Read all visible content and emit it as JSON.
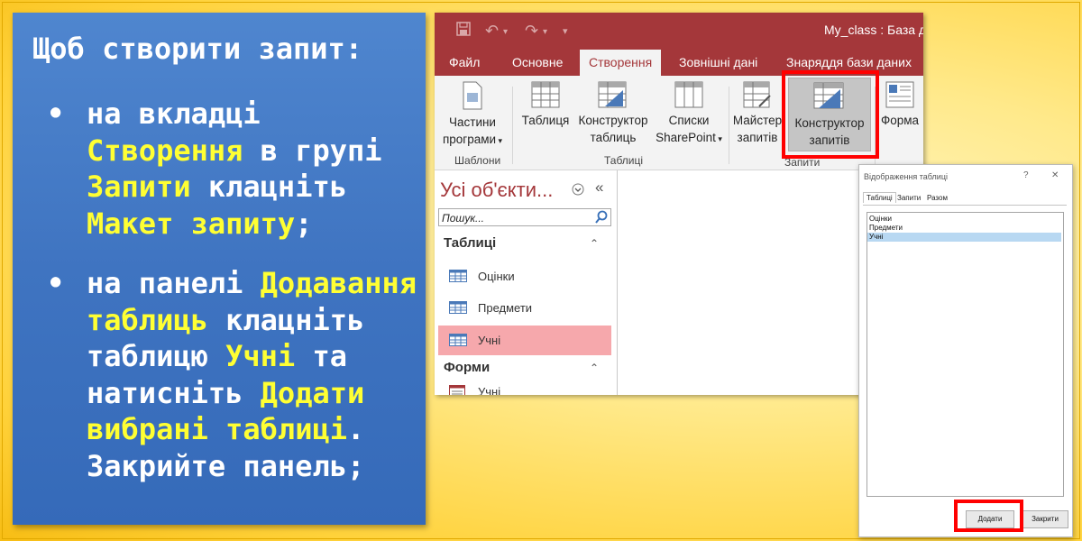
{
  "instructions": {
    "heading": "Щоб створити запит:",
    "bullet1": {
      "lines": [
        "на вкладці",
        "Створення в групі",
        "Запити клацніть",
        "Макет запиту;"
      ],
      "p1": "на вкладці ",
      "h1": "Створення",
      "p2": " в групі ",
      "h2": "Запити",
      "p3": " клацніть ",
      "h3": "Макет запиту",
      "p4": ";"
    },
    "bullet2": {
      "p1": "на панелі ",
      "h1": "Додавання таблиць",
      "p2": " клацніть таблицю ",
      "h2": "Учні",
      "p3": " та натисніть ",
      "h3": "Додати вибрані таблиці",
      "p4": ". Закрийте панель;"
    },
    "bullet_glyph": "•"
  },
  "access": {
    "title": "My_class : База да",
    "tabs": [
      "Файл",
      "Основне",
      "Створення",
      "Зовнішні дані",
      "Знаряддя бази даних"
    ],
    "active_tab": "Створення",
    "ribbon": {
      "app_parts": {
        "label_line1": "Частини",
        "label_line2": "програми",
        "group": "Шаблони"
      },
      "table": {
        "label": "Таблиця"
      },
      "table_design": {
        "label_line1": "Конструктор",
        "label_line2": "таблиць"
      },
      "sharepoint": {
        "label_line1": "Списки",
        "label_line2": "SharePoint"
      },
      "query_wizard": {
        "label_line1": "Майстер",
        "label_line2": "запитів"
      },
      "query_design": {
        "label_line1": "Конструктор",
        "label_line2": "запитів"
      },
      "form": {
        "label": "Форма"
      },
      "group_tables": "Таблиці",
      "group_queries": "Запити"
    },
    "nav": {
      "title": "Усі об'єкти...",
      "search_placeholder": "Пошук...",
      "sections": [
        {
          "label": "Таблиці",
          "items": [
            "Оцінки",
            "Предмети",
            "Учні"
          ]
        },
        {
          "label": "Форми",
          "items": [
            "Учні"
          ]
        }
      ],
      "selected_item": "Учні"
    }
  },
  "dialog": {
    "title": "Відображення таблиці",
    "help": "?",
    "close": "✕",
    "tabs": [
      "Таблиці",
      "Запити",
      "Разом"
    ],
    "items": [
      "Оцінки",
      "Предмети",
      "Учні"
    ],
    "selected": "Учні",
    "add_button": "Додати",
    "close_button": "Закрити"
  },
  "colors": {
    "access_accent": "#a4373a",
    "panel_blue": "#3f74c1",
    "highlight_text": "#ffff33",
    "callout_red": "#ff0000"
  }
}
